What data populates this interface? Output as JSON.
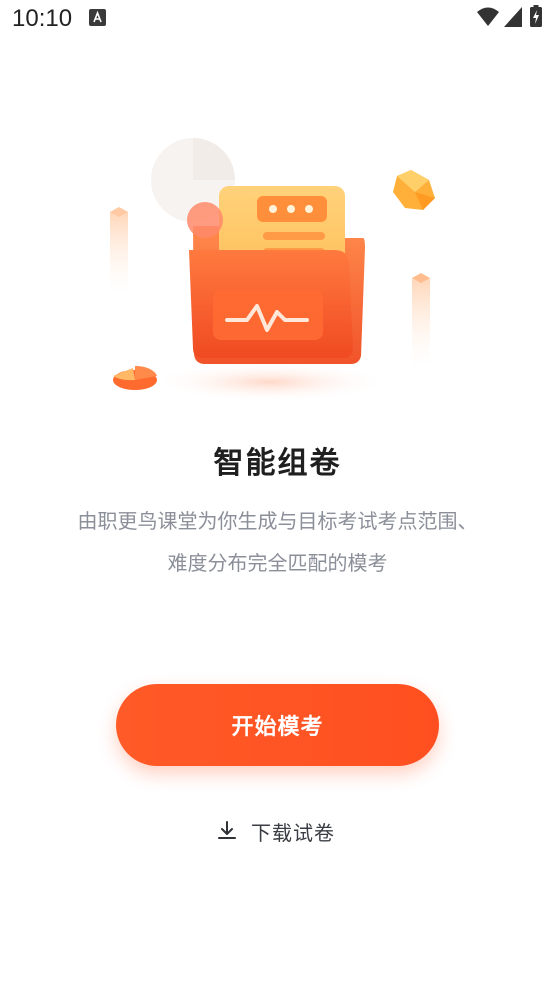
{
  "status_bar": {
    "time": "10:10",
    "notification_icon": "a-icon",
    "wifi_icon": "wifi-icon",
    "signal_icon": "signal-icon",
    "battery_icon": "battery-charging-icon"
  },
  "illustration": {
    "icon": "folder-document-pulse-icon"
  },
  "main": {
    "title": "智能组卷",
    "description_line1": "由职更鸟课堂为你生成与目标考试考点范围、",
    "description_line2": "难度分布完全匹配的模考"
  },
  "actions": {
    "start_label": "开始模考",
    "download_label": "下载试卷",
    "download_icon": "download-icon"
  },
  "colors": {
    "accent": "#FF5322",
    "title_text": "#1F1F1F",
    "description_text": "#8B8F99",
    "download_text": "#3A3D44"
  }
}
